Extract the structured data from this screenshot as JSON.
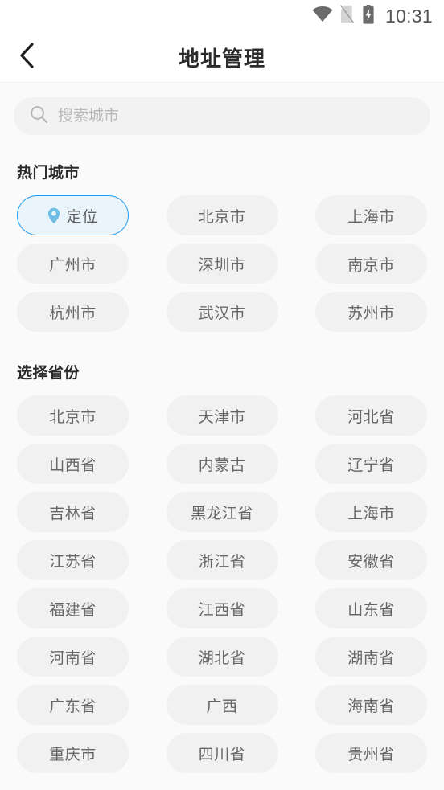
{
  "status_bar": {
    "time": "10:31",
    "icons": [
      "wifi-icon",
      "no-sim-icon",
      "battery-charging-icon"
    ]
  },
  "header": {
    "back_icon": "chevron-left-icon",
    "title": "地址管理"
  },
  "search": {
    "icon": "search-icon",
    "placeholder": "搜索城市",
    "value": ""
  },
  "hot_cities": {
    "title": "热门城市",
    "locate_chip": {
      "label": "定位",
      "icon": "location-pin-icon",
      "selected": true,
      "border_color": "#1e9bf5",
      "fill_color": "#e9f4fb"
    },
    "items": [
      "北京市",
      "上海市",
      "广州市",
      "深圳市",
      "南京市",
      "杭州市",
      "武汉市",
      "苏州市"
    ]
  },
  "provinces": {
    "title": "选择省份",
    "items": [
      "北京市",
      "天津市",
      "河北省",
      "山西省",
      "内蒙古",
      "辽宁省",
      "吉林省",
      "黑龙江省",
      "上海市",
      "江苏省",
      "浙江省",
      "安徽省",
      "福建省",
      "江西省",
      "山东省",
      "河南省",
      "湖北省",
      "湖南省",
      "广东省",
      "广西",
      "海南省",
      "重庆市",
      "四川省",
      "贵州省"
    ]
  },
  "colors": {
    "page_background": "#fafafa",
    "header_background": "#ffffff",
    "chip_background": "#f1f1f1",
    "chip_text": "#666666",
    "accent": "#1e9bf5"
  }
}
